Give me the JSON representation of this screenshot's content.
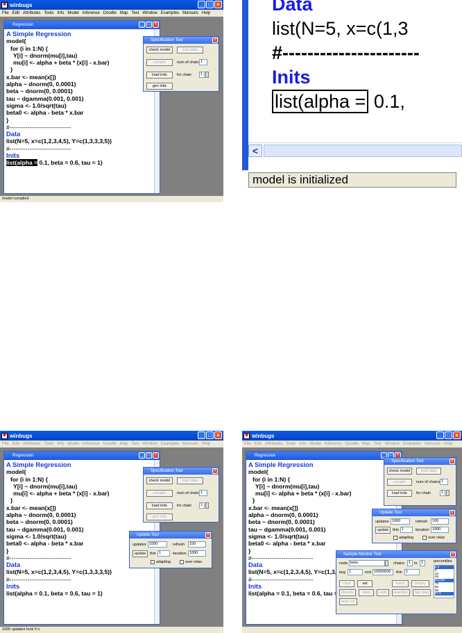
{
  "app": {
    "title": "winbugs",
    "doc_title": "Regression",
    "menu": [
      "File",
      "Edit",
      "Attributes",
      "Tools",
      "Info",
      "Model",
      "Inference",
      "Doodle",
      "Map",
      "Text",
      "Window",
      "Examples",
      "Manuals",
      "Help"
    ],
    "minimize": "_",
    "maximize": "□",
    "close": "×"
  },
  "code": {
    "heading": "A Simple Regression",
    "lines": [
      "model{",
      "for (i in 1:N) {",
      "Y[i] ~ dnorm(mu[i],tau)",
      "mu[i] <- alpha + beta * (x[i] - x.bar)",
      "}",
      "x.bar <- mean(x[])",
      "alpha ~ dnorm(0, 0.0001)",
      "beta ~ dnorm(0, 0.0001)",
      "tau ~ dgamma(0.001, 0.001)",
      "sigma <- 1.0/sqrt(tau)",
      "beta0 <- alpha - beta * x.bar",
      "}",
      "#-------------------------------"
    ],
    "data_heading": "Data",
    "data_line": "list(N=5, x=c(1,2,3,4,5), Y=c(1,3,3,3,5))",
    "sep": "#-------------------------------",
    "inits_heading": "Inits",
    "inits_sel": "list(alpha =",
    "inits_rest": " 0.1, beta = 0.6, tau = 1)",
    "inits_full": "list(alpha = 0.1, beta = 0.6, tau = 1)"
  },
  "spec_tool": {
    "title": "Specification Tool",
    "check_model": "check model",
    "load_data": "load data",
    "compile": "compile",
    "num_chains_label": "num of chains",
    "num_chains": "1",
    "load_inits": "load inits",
    "for_chain_label": "for chain",
    "for_chain": "1",
    "gen_inits": "gen inits"
  },
  "update_tool": {
    "title": "Update Tool",
    "updates_label": "updates",
    "updates": "1000",
    "refresh_label": "refresh",
    "refresh": "100",
    "update_btn": "update",
    "thin_label": "thin",
    "thin": "1",
    "iteration_label": "iteration",
    "iteration": "1000",
    "adapting": "adapting",
    "over_relax": "over relax"
  },
  "monitor_tool": {
    "title": "Sample Monitor Tool",
    "node_label": "node",
    "node": "beta",
    "chains_label": "chains",
    "chains_from": "1",
    "to_label": "to",
    "chains_to": "1",
    "percentiles_label": "percentiles",
    "beg_label": "beg",
    "beg": "1",
    "end_label": "end",
    "end": "10000000",
    "thin_label": "thin",
    "thin": "1",
    "clear": "clear",
    "set": "set",
    "trace": "trace",
    "history": "history",
    "density": "density",
    "stats": "stats",
    "coda": "coda",
    "quantiles": "quantiles",
    "bgr_diag": "bgr diag",
    "auto_cor": "auto cor",
    "percentiles": [
      "2.5",
      "5",
      "10",
      "25",
      "median",
      "75",
      "90",
      "95",
      "97.5"
    ]
  },
  "status": {
    "p1": "model compiled",
    "p2": "model is initialized",
    "p3": "1000 updates took 0 s"
  },
  "zoom": {
    "line1": "Data",
    "line2": "list(N=5, x=c(1,3",
    "line3": "#----------------------",
    "line4": "Inits",
    "line5_sel": "list(alpha =",
    "line5_rest": " 0.1,",
    "scroll_left": "<"
  }
}
